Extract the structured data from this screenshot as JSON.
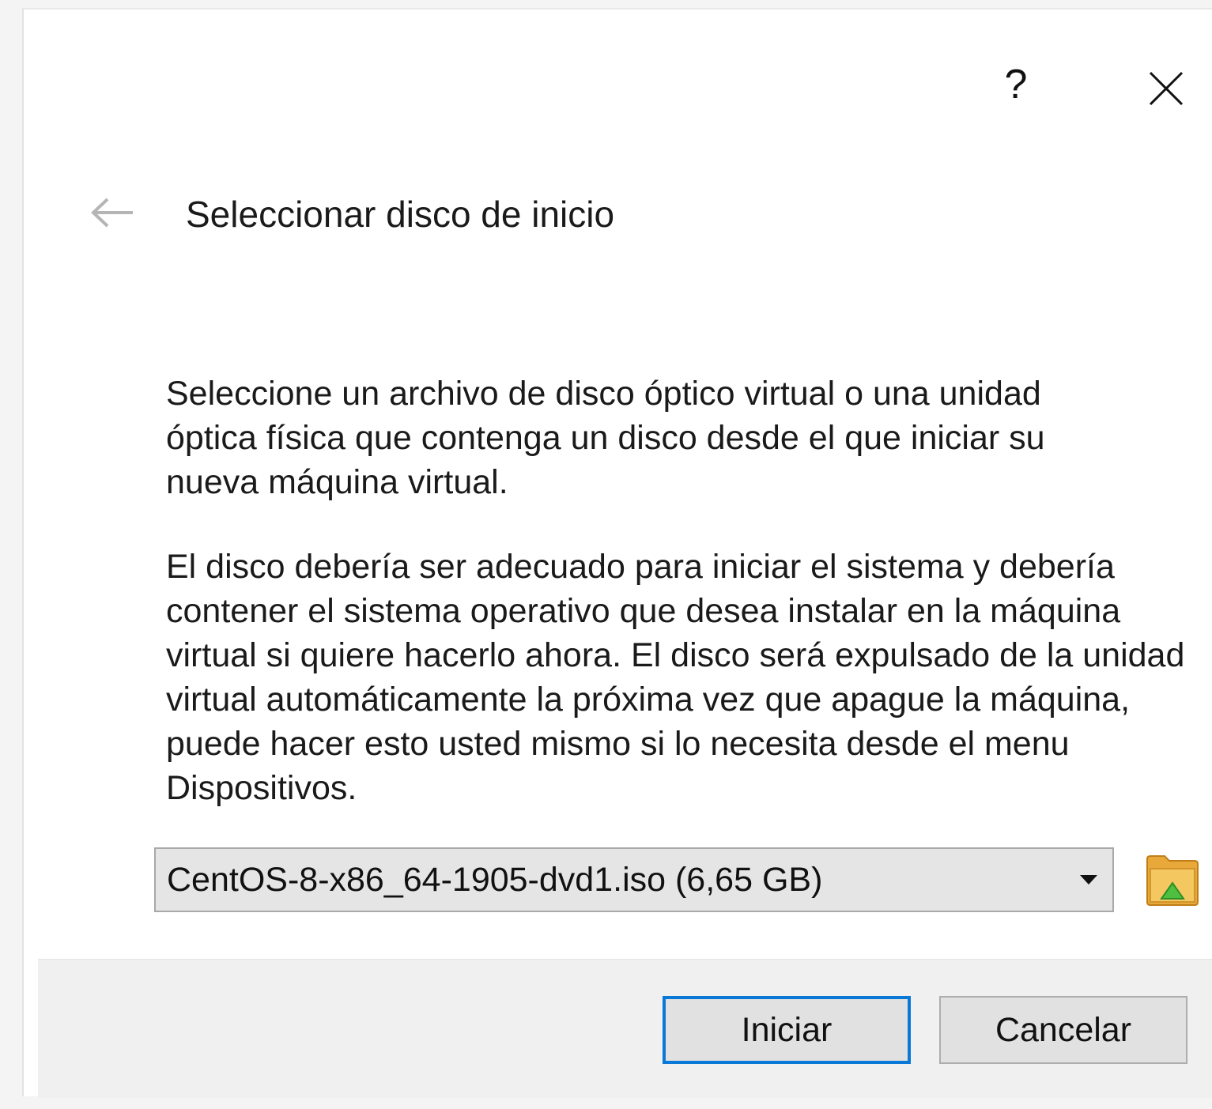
{
  "titlebar": {
    "help_label": "?",
    "close_icon": "close-icon"
  },
  "header": {
    "back_icon": "back-arrow-icon",
    "title": "Seleccionar disco de inicio"
  },
  "body": {
    "paragraph1": "Seleccione un archivo de disco óptico virtual o una unidad óptica física que contenga un disco desde el que iniciar su nueva máquina virtual.",
    "paragraph2": "El disco debería ser adecuado para iniciar el sistema y debería contener el sistema operativo que desea instalar en la máquina virtual si quiere hacerlo ahora. El disco será expulsado de la unidad virtual automáticamente la próxima vez que apague la máquina, puede hacer esto usted mismo si lo necesita desde el menu Dispositivos."
  },
  "disk_selector": {
    "selected_value": "CentOS-8-x86_64-1905-dvd1.iso (6,65 GB)",
    "dropdown_icon": "chevron-down-icon",
    "browse_icon": "folder-open-icon"
  },
  "footer": {
    "start_label": "Iniciar",
    "cancel_label": "Cancelar"
  },
  "colors": {
    "accent": "#0a78d7",
    "folder": "#e8a93a",
    "folder_arrow": "#4fbf3f"
  }
}
